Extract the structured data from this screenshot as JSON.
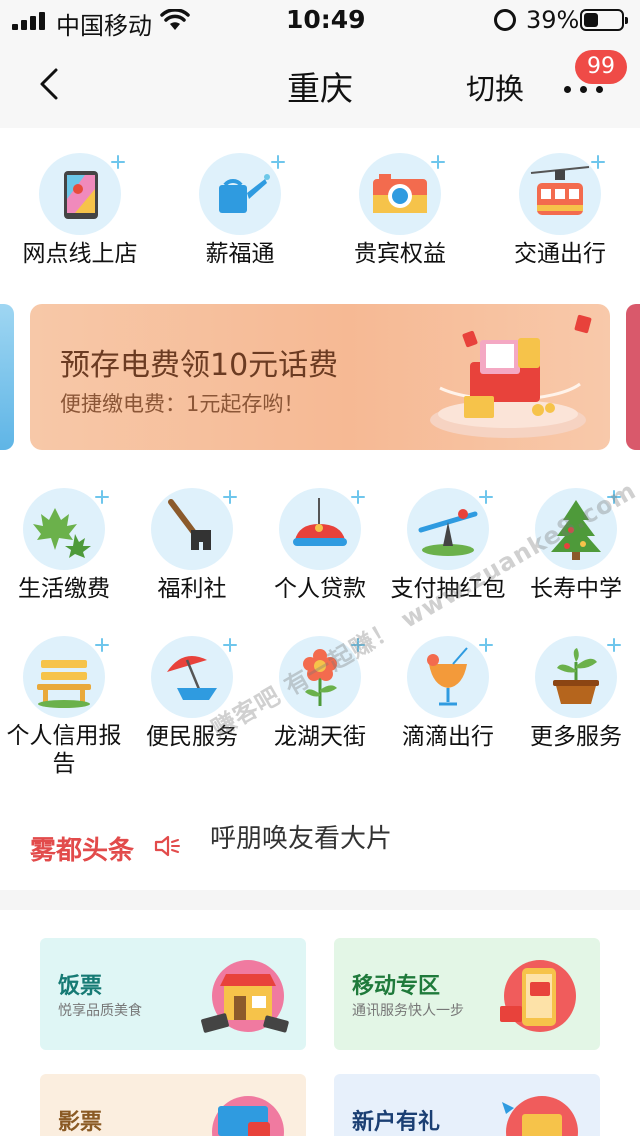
{
  "status_bar": {
    "carrier": "中国移动",
    "time": "10:49",
    "battery_percent": "39%",
    "battery_level": 0.39
  },
  "nav": {
    "title": "重庆",
    "switch_label": "切换",
    "badge_count": "99"
  },
  "top_services": [
    {
      "label": "网点线上店",
      "icon": "tablet-map-icon"
    },
    {
      "label": "薪福通",
      "icon": "watering-can-icon"
    },
    {
      "label": "贵宾权益",
      "icon": "camera-icon"
    },
    {
      "label": "交通出行",
      "icon": "cable-car-icon"
    }
  ],
  "banner": {
    "title": "预存电费领10元话费",
    "subtitle": "便捷缴电费：1元起存哟！"
  },
  "services_row1": [
    {
      "label": "生活缴费",
      "icon": "maple-leaf-icon"
    },
    {
      "label": "福利社",
      "icon": "shovel-icon"
    },
    {
      "label": "个人贷款",
      "icon": "bumper-car-icon"
    },
    {
      "label": "支付抽红包",
      "icon": "seesaw-icon"
    },
    {
      "label": "长寿中学",
      "icon": "christmas-tree-icon"
    }
  ],
  "services_row2": [
    {
      "label": "个人信用报告",
      "icon": "bench-icon"
    },
    {
      "label": "便民服务",
      "icon": "beach-umbrella-icon"
    },
    {
      "label": "龙湖天街",
      "icon": "flower-icon"
    },
    {
      "label": "滴滴出行",
      "icon": "cocktail-icon"
    },
    {
      "label": "更多服务",
      "icon": "potted-plant-icon"
    }
  ],
  "news": {
    "label": "雾都头条",
    "headline": "呼朋唤友看大片"
  },
  "cards": [
    {
      "title": "饭票",
      "subtitle": "悦享品质美食",
      "bg": "#dff6f5",
      "title_color": "#167a74"
    },
    {
      "title": "移动专区",
      "subtitle": "通讯服务快人一步",
      "bg": "#e3f6e6",
      "title_color": "#1f7a3b"
    },
    {
      "title": "影票",
      "subtitle": "",
      "bg": "#fbeedf",
      "title_color": "#8a5a24"
    },
    {
      "title": "新户有礼",
      "subtitle": "",
      "bg": "#e7f0fb",
      "title_color": "#1b3f73"
    }
  ],
  "watermark": "赚客吧 有一起赚！ www.zuanke8.com",
  "colors": {
    "accent_red": "#e24b4b",
    "badge": "#ef4b47",
    "icon_circle": "#dff1fb"
  }
}
